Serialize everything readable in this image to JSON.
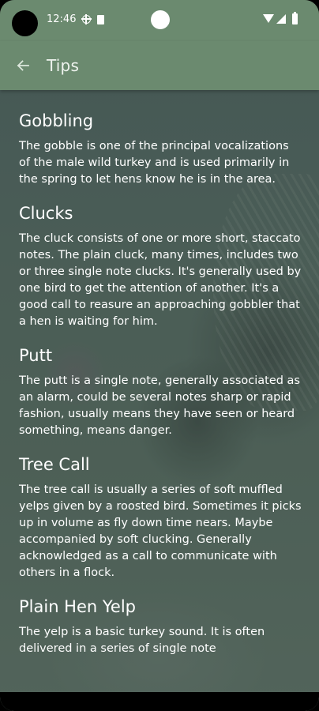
{
  "status_bar": {
    "time": "12:46",
    "icons": [
      "sync-icon",
      "sim-card-icon",
      "wifi-icon",
      "signal-icon",
      "battery-icon"
    ]
  },
  "app_bar": {
    "title": "Tips",
    "back_icon": "arrow-left-icon",
    "background_color": "#6b8a6f"
  },
  "tips": [
    {
      "title": "Gobbling",
      "body": "The gobble is one of the principal vocalizations of the male wild turkey and is used primarily in the spring to let hens know he is in the area."
    },
    {
      "title": "Clucks",
      "body": "The cluck consists of one or more short, staccato notes. The plain cluck, many times, includes two or three single note clucks. It's generally used by one bird to get the attention of another. It's a good call to reasure an approaching gobbler that a hen is waiting for him."
    },
    {
      "title": "Putt",
      "body": "The putt is a single note, generally associated as an alarm, could be several notes sharp or rapid fashion, usually means they have seen or heard something, means danger."
    },
    {
      "title": "Tree Call",
      "body": "The tree call is usually a series of soft muffled yelps given by a roosted bird. Sometimes it picks up in volume as fly down time nears. Maybe accompanied by soft clucking. Generally acknowledged as a call to communicate with others in a flock."
    },
    {
      "title": "Plain Hen Yelp",
      "body": "The yelp is a basic turkey sound. It is often delivered in a series of single note"
    }
  ]
}
